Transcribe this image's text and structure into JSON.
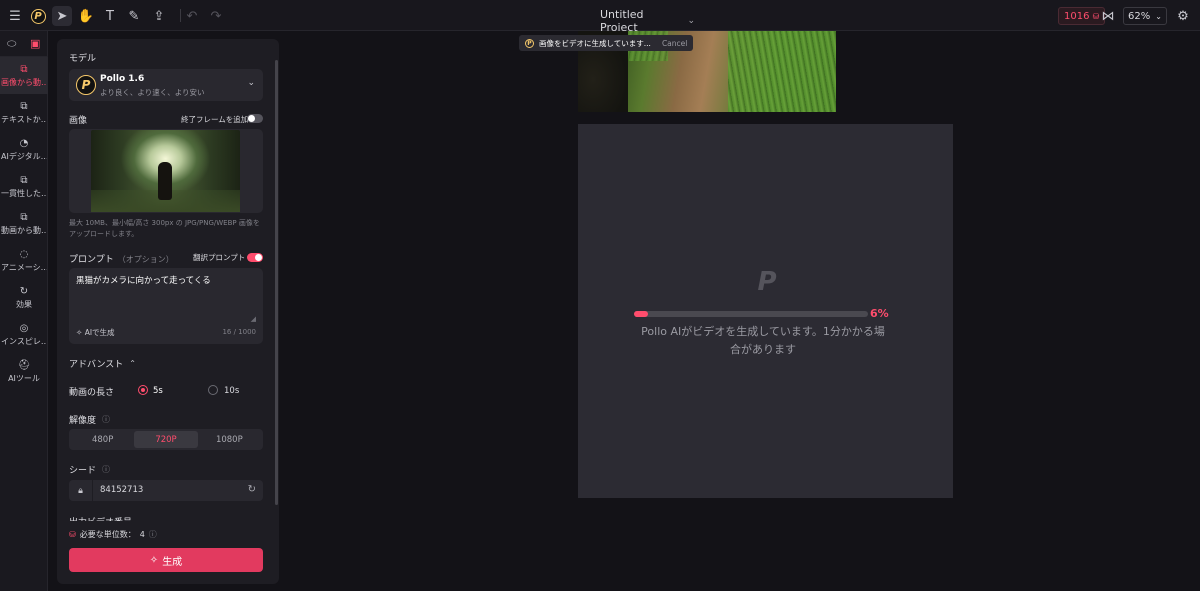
{
  "colors": {
    "accent": "#ff4d6d",
    "panel": "#1e1d23",
    "canvas_bg": "#131217"
  },
  "topbar": {
    "project_title": "Untitled Project",
    "credits": "1016",
    "zoom": "62%",
    "icons": [
      "menu-icon",
      "pollo-logo",
      "select-tool-icon",
      "hand-tool-icon",
      "text-tool-icon",
      "brush-tool-icon",
      "upload-icon",
      "undo-icon",
      "redo-icon",
      "share-icon",
      "settings-icon"
    ]
  },
  "rail": {
    "items": [
      {
        "label": "画像から動…",
        "icon": "image-to-video-icon"
      },
      {
        "label": "テキストか…",
        "icon": "text-to-video-icon"
      },
      {
        "label": "AIデジタル…",
        "icon": "ai-digital-icon"
      },
      {
        "label": "一貫性した…",
        "icon": "consistent-icon"
      },
      {
        "label": "動画から動…",
        "icon": "video-to-video-icon"
      },
      {
        "label": "アニメーシ…",
        "icon": "animation-icon"
      },
      {
        "label": "効果",
        "icon": "effects-icon"
      },
      {
        "label": "インスピレ…",
        "icon": "inspiration-icon"
      },
      {
        "label": "AIツール",
        "icon": "ai-tools-icon"
      }
    ]
  },
  "panel": {
    "model_label": "モデル",
    "model_name": "Pollo 1.6",
    "model_sub": "より良く、より速く、より安い",
    "image_label": "画像",
    "end_frame_label": "終了フレームを追加",
    "image_hint": "最大 10MB、最小幅/高さ 300px の JPG/PNG/WEBP 画像をアップロードします。",
    "prompt_label": "プロンプト",
    "prompt_optional": "（オプション）",
    "translate_label": "翻訳プロンプト",
    "prompt_text": "黒猫がカメラに向かって走ってくる",
    "ai_generate": "AIで生成",
    "prompt_counter": "16 / 1000",
    "advanced_label": "アドバンスト",
    "duration_label": "動画の長さ",
    "duration_options": [
      "5s",
      "10s"
    ],
    "duration_selected": "5s",
    "resolution_label": "解像度",
    "resolution_options": [
      "480P",
      "720P",
      "1080P"
    ],
    "resolution_selected": "720P",
    "seed_label": "シード",
    "seed_value": "84152713",
    "output_label": "出力ビデオ番号",
    "units_label": "必要な単位数：",
    "units_value": "4",
    "generate_button": "生成"
  },
  "canvas": {
    "toast_text": "画像をビデオに生成しています...",
    "toast_cancel": "Cancel",
    "progress_percent": 6,
    "progress_text": "6%",
    "message": "Pollo AIがビデオを生成しています。1分かかる場合があります"
  }
}
